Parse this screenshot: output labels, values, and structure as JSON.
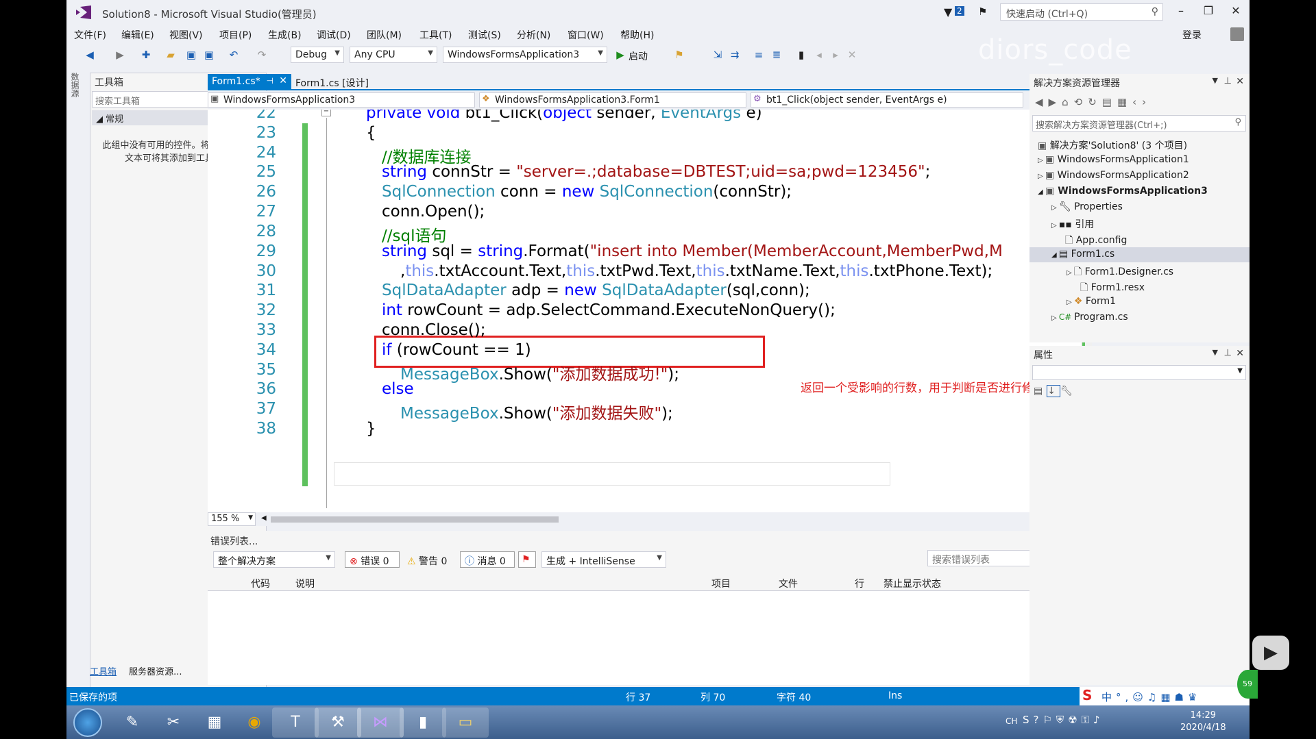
{
  "window": {
    "title": "Solution8 - Microsoft Visual Studio(管理员)",
    "quick_launch_placeholder": "快速启动 (Ctrl+Q)",
    "notification_count": "2",
    "login": "登录",
    "watermark": "diors_code"
  },
  "menu": [
    "文件(F)",
    "编辑(E)",
    "视图(V)",
    "项目(P)",
    "生成(B)",
    "调试(D)",
    "团队(M)",
    "工具(T)",
    "测试(S)",
    "分析(N)",
    "窗口(W)",
    "帮助(H)"
  ],
  "toolbar": {
    "config": "Debug",
    "platform": "Any CPU",
    "startup_project": "WindowsFormsApplication3",
    "start_label": "启动"
  },
  "toolbox": {
    "title": "工具箱",
    "search_placeholder": "搜索工具箱",
    "category": "常规",
    "empty_text": "此组中没有可用的控件。将某项拖至此文本可将其添加到工具箱。",
    "bottom_tabs": [
      "工具箱",
      "服务器资源..."
    ],
    "side_tab": "数据源"
  },
  "editor": {
    "tabs": [
      "Form1.cs*",
      "Form1.cs [设计]"
    ],
    "nav": [
      "WindowsFormsApplication3",
      "WindowsFormsApplication3.Form1",
      "bt1_Click(object sender, EventArgs e)"
    ],
    "zoom": "155 %",
    "lines": [
      {
        "n": "22",
        "text": "private void bt1_Click(object sender, EventArgs e)"
      },
      {
        "n": "23",
        "text": "{"
      },
      {
        "n": "24",
        "text": "//数据库连接"
      },
      {
        "n": "25",
        "text": "string connStr = \"server=.;database=DBTEST;uid=sa;pwd=123456\";"
      },
      {
        "n": "26",
        "text": "SqlConnection conn = new SqlConnection(connStr);"
      },
      {
        "n": "27",
        "text": "conn.Open();"
      },
      {
        "n": "28",
        "text": "//sql语句"
      },
      {
        "n": "29",
        "text": "string sql = string.Format(\"insert into Member(MemberAccount,MemberPwd,M"
      },
      {
        "n": "30",
        "text": ",this.txtAccount.Text,this.txtPwd.Text,this.txtName.Text,this.txtPhone.Text);"
      },
      {
        "n": "31",
        "text": "SqlDataAdapter adp = new SqlDataAdapter(sql,conn);"
      },
      {
        "n": "32",
        "text": "int rowCount = adp.SelectCommand.ExecuteNonQuery();"
      },
      {
        "n": "33",
        "text": "conn.Close();"
      },
      {
        "n": "34",
        "text": "if (rowCount == 1)"
      },
      {
        "n": "35",
        "text": "MessageBox.Show(\"添加数据成功!\");"
      },
      {
        "n": "36",
        "text": "else"
      },
      {
        "n": "37",
        "text": "MessageBox.Show(\"添加数据失败\");"
      },
      {
        "n": "38",
        "text": "}"
      }
    ],
    "annotation": "返回一个受影响的行数，用于判断是否进行修改或添加"
  },
  "error_list": {
    "title": "错误列表...",
    "scope": "整个解决方案",
    "errors": "错误 0",
    "warnings": "警告 0",
    "messages": "消息 0",
    "build_filter": "生成 + IntelliSense",
    "search_placeholder": "搜索错误列表",
    "columns": [
      "代码",
      "说明",
      "项目",
      "文件",
      "行",
      "禁止显示状态"
    ]
  },
  "solution_explorer": {
    "title": "解决方案资源管理器",
    "search_placeholder": "搜索解决方案资源管理器(Ctrl+;)",
    "items": [
      "解决方案'Solution8' (3 个项目)",
      "WindowsFormsApplication1",
      "WindowsFormsApplication2",
      "WindowsFormsApplication3",
      "Properties",
      "引用",
      "App.config",
      "Form1.cs",
      "Form1.Designer.cs",
      "Form1.resx",
      "Form1",
      "Program.cs"
    ]
  },
  "properties": {
    "title": "属性"
  },
  "status": {
    "left": "已保存的项",
    "row": "行 37",
    "col": "列 70",
    "char": "字符 40",
    "mode": "Ins"
  },
  "taskbar": {
    "time": "14:29",
    "date": "2020/4/18",
    "lang": "CH",
    "badge": "59"
  }
}
